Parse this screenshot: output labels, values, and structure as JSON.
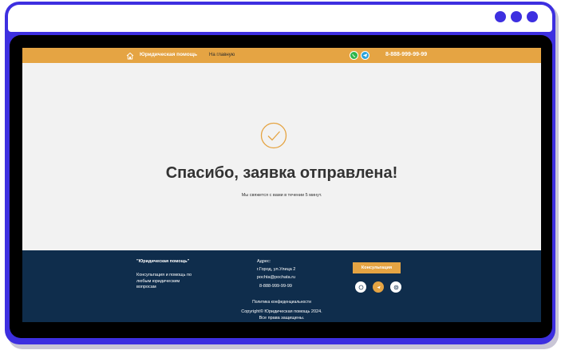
{
  "header": {
    "logo_text": "Юридическая помощь",
    "nav_home": "На главную",
    "phone": "8-888-999-99-99"
  },
  "main": {
    "title": "Спасибо, заявка отправлена!",
    "subtitle": "Мы свяжется с вами в течении 5 минут."
  },
  "footer": {
    "brand": "\"Юридическая помощь\"",
    "description": "Консультация и помощь по любым юридическим вопросам",
    "address_label": "Адрес:",
    "address_line": "г.Город, ул.Улица 2",
    "email": "pochta@pochata.ru",
    "phone": "8-888-999-99-99",
    "consult_button": "Консультация",
    "privacy": "Политика конфиденциальности",
    "copyright_line1": "Copyright© Юридическая помощь 2024.",
    "copyright_line2": "Все права защищены."
  },
  "colors": {
    "frame": "#3d2fe0",
    "accent": "#e5a443",
    "footer_bg": "#0f2d4c",
    "whatsapp": "#2fb54a",
    "telegram": "#2aa3dc"
  },
  "icons": [
    "home-icon",
    "whatsapp-icon",
    "telegram-icon",
    "check-circle-icon",
    "email-icon"
  ]
}
